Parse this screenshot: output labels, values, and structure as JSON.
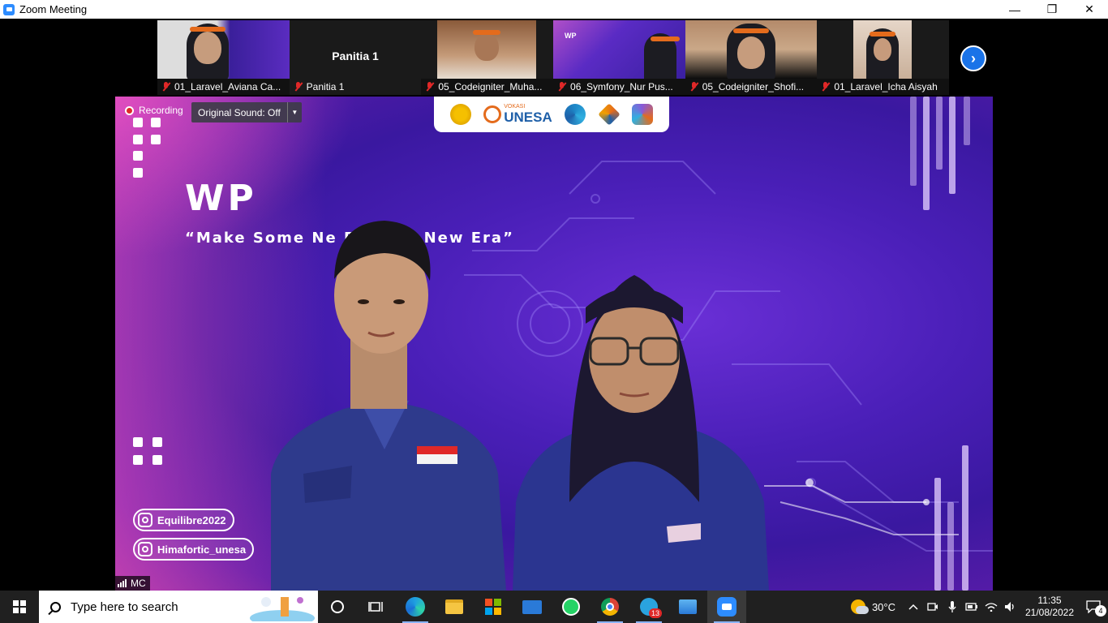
{
  "window": {
    "title": "Zoom Meeting",
    "minimize": "—",
    "restore": "❐",
    "close": "✕"
  },
  "gallery": {
    "tiles": [
      {
        "name": "01_Laravel_Aviana Ca...",
        "muted": true
      },
      {
        "name": "Panitia 1",
        "display_name": "Panitia 1",
        "muted": true
      },
      {
        "name": "05_Codeigniter_Muha...",
        "muted": true
      },
      {
        "name": "06_Symfony_Nur Pus...",
        "muted": true
      },
      {
        "name": "05_Codeigniter_Shofi...",
        "muted": true
      },
      {
        "name": "01_Laravel_Icha Aisyah",
        "muted": true
      }
    ],
    "next_icon": "›",
    "mini_wp": "WP"
  },
  "speaker": {
    "recording_label": "Recording",
    "sound_label": "Original Sound: Off",
    "sound_arrow": "▼",
    "logo_text": "UNESA",
    "logo_vokasi": "VOKASI",
    "wp_title": "WP",
    "tagline": "“Make Some Ne        For The New Era”",
    "social1": "Equilibre2022",
    "social2": "Himafortic_unesa",
    "name_label": "MC"
  },
  "taskbar": {
    "search_placeholder": "Type here to search",
    "telegram_badge": "13",
    "weather_temp": "30°C",
    "time": "11:35",
    "date": "21/08/2022",
    "notification_count": "4"
  }
}
